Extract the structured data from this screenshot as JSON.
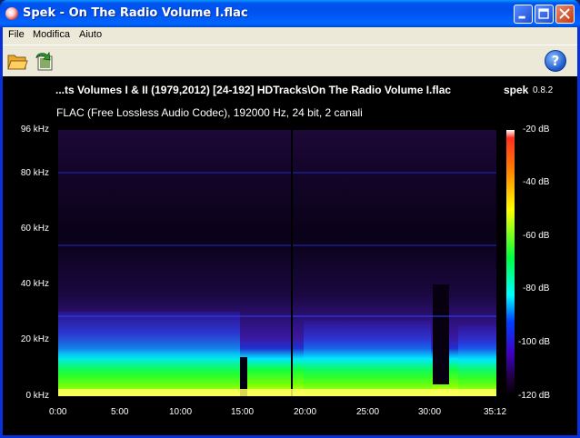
{
  "window": {
    "title": "Spek - On The Radio Volume I.flac",
    "app_icon": "spek-app-icon",
    "controls": [
      "minimize-icon",
      "maximize-icon",
      "close-icon"
    ],
    "accent": "#0053ee"
  },
  "menu": {
    "items": [
      {
        "label": "File"
      },
      {
        "label": "Modifica"
      },
      {
        "label": "Aiuto"
      }
    ]
  },
  "toolbar": {
    "open_icon": "folder-open-icon",
    "save_icon": "save-image-icon",
    "help_label": "?",
    "help_icon": "help-icon"
  },
  "viewer": {
    "file_title": "...ts Volumes I & II (1979,2012) [24-192] HDTracks\\On The Radio Volume I.flac",
    "app_name": "spek",
    "app_version": "0.8.2",
    "file_info": "FLAC (Free Lossless Audio Codec), 192000 Hz, 24 bit, 2 canali",
    "freq_ticks": [
      "96 kHz",
      "80 kHz",
      "60 kHz",
      "40 kHz",
      "20 kHz",
      "0 kHz"
    ],
    "time_ticks": [
      "0:00",
      "5:00",
      "10:00",
      "15:00",
      "20:00",
      "25:00",
      "30:00",
      "35:12"
    ],
    "db_ticks": [
      "-20 dB",
      "-40 dB",
      "-60 dB",
      "-80 dB",
      "-100 dB",
      "-120 dB"
    ],
    "background": "#000000"
  }
}
